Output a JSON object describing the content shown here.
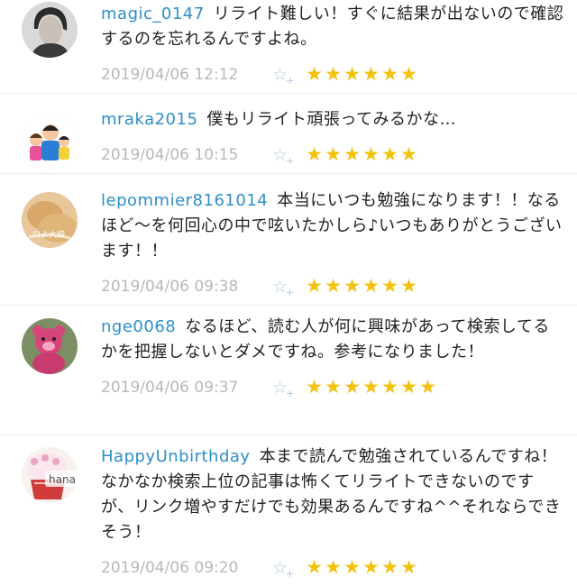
{
  "comments": [
    {
      "username": "magic_0147",
      "text": "リライト難しい！すぐに結果が出ないので確認するのを忘れるんですよね。",
      "timestamp": "2019/04/06 12:12",
      "add_star_icon": "star-outline-plus-icon",
      "stars": 6,
      "avatar": "man-portrait"
    },
    {
      "username": "mraka2015",
      "text": "僕もリライト頑張ってみるかな…",
      "timestamp": "2019/04/06 10:15",
      "add_star_icon": "star-outline-plus-icon",
      "stars": 6,
      "avatar": "family-illustration"
    },
    {
      "username": "lepommier8161014",
      "text": "本当にいつも勉強になります！！なるほど～を何回心の中で呟いたかしら♪いつもありがとうございます！！",
      "timestamp": "2019/04/06 09:38",
      "add_star_icon": "star-outline-plus-icon",
      "stars": 6,
      "avatar": "bread-photo"
    },
    {
      "username": "nge0068",
      "text": "なるほど、読む人が何に興味があって検索してるかを把握しないとダメですね。参考になりました！",
      "timestamp": "2019/04/06 09:37",
      "add_star_icon": "star-outline-plus-icon",
      "stars": 7,
      "avatar": "pink-bear-toy"
    },
    {
      "username": "HappyUnbirthday",
      "text": "本まで読んで勉強されているんですね！なかなか検索上位の記事は怖くてリライトできないのですが、リンク増やすだけでも効果あるんですね^^それならできそう！",
      "timestamp": "2019/04/06 09:20",
      "add_star_icon": "star-outline-plus-icon",
      "stars": 6,
      "avatar": "cupcake-hana",
      "avatar_text": "hana"
    }
  ],
  "colors": {
    "username": "#2d8fc7",
    "timestamp": "#b8b8b8",
    "star": "#f3c20e",
    "add_star": "#aac9e6",
    "text": "#222222"
  }
}
